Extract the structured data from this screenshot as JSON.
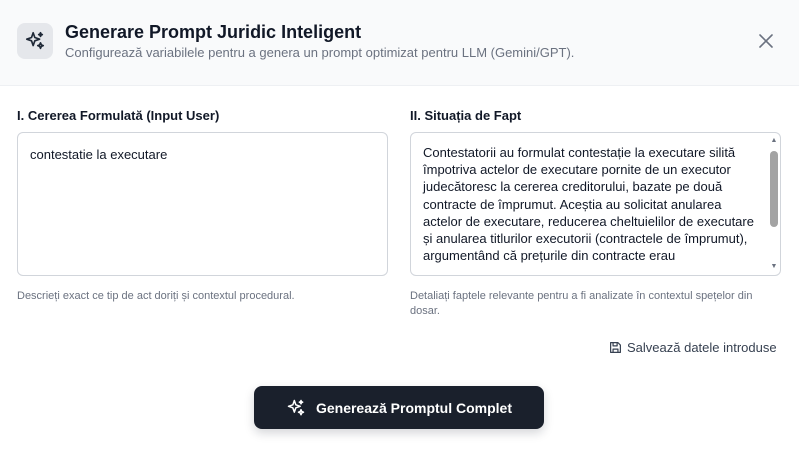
{
  "header": {
    "icon": "sparkles-icon",
    "title": "Generare Prompt Juridic Inteligent",
    "subtitle": "Configurează variabilele pentru a genera un prompt optimizat pentru LLM (Gemini/GPT).",
    "close_icon": "close-icon"
  },
  "request_field": {
    "label": "I. Cererea Formulată (Input User)",
    "value": "contestatie la executare",
    "helper": "Descrieți exact ce tip de act doriți și contextul procedural."
  },
  "facts_field": {
    "label": "II. Situația de Fapt",
    "value": "Contestatorii au formulat contestație la executare silită împotriva actelor de executare pornite de un executor judecătoresc la cererea creditorului, bazate pe două contracte de împrumut. Aceștia au solicitat anularea actelor de executare, reducerea cheltuielilor de executare și anularea titlurilor executorii (contractele de împrumut), argumentând că prețurile din contracte erau",
    "helper": "Detaliați faptele relevante pentru a fi analizate în contextul spețelor din dosar."
  },
  "save": {
    "icon": "save-icon",
    "label": "Salvează datele introduse"
  },
  "generate": {
    "icon": "sparkles-icon",
    "label": "Generează Promptul Complet"
  },
  "colors": {
    "primary_button": "#1a202c",
    "header_bg": "#f9fafb",
    "muted_text": "#6b7280",
    "border": "#d1d5db"
  }
}
